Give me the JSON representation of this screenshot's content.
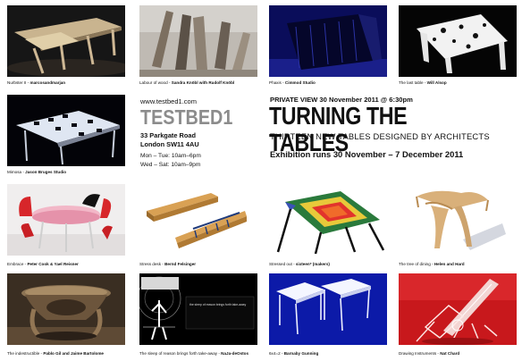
{
  "website": "www.testbed1.com",
  "gallery": "TESTBED1",
  "address": [
    "33 Parkgate Road",
    "London SW11 4AU"
  ],
  "hours": [
    "Mon – Tue: 10am–6pm",
    "Wed – Sat: 10am–9pm"
  ],
  "private_view": "PRIVATE VIEW  30 November 2011 @ 6:30pm",
  "title": "TURNING THE TABLES",
  "subtitle": "THIRTEEN NEW TABLES DESIGNED BY ARCHITECTS",
  "exhibition_runs": "Exhibition runs 30 November – 7 December 2011",
  "tables": [
    {
      "name": "Nurbster II - ",
      "designer": "marcosandmarjan"
    },
    {
      "name": "Labour of wood - ",
      "designer": "Sandra Knöbl with Rudolf Knöbl"
    },
    {
      "name": "Phaxis - ",
      "designer": "Cimmod Studio"
    },
    {
      "name": "The last table - ",
      "designer": "Will Alsop"
    },
    {
      "name": "Mimosa - ",
      "designer": "Jason Bruges Studio"
    },
    {
      "name": "Embrace - ",
      "designer": "Peter Cook & Yael Reisner"
    },
    {
      "name": "Stress desk - ",
      "designer": "Bernd Felsinger"
    },
    {
      "name": "Stressed out - ",
      "designer": "sixteen* (makers)"
    },
    {
      "name": "The tree of dining - ",
      "designer": "Helen and Hard"
    },
    {
      "name": "The indestructible - ",
      "designer": "Pablo Gil and Jaime Bartolome"
    },
    {
      "name": "The sleep of reason brings forth take-away - ",
      "designer": "NaJa-deOstos"
    },
    {
      "name": "6x4=2 - ",
      "designer": "Barnaby Gunning"
    },
    {
      "name": "Drawing Instruments - ",
      "designer": "Nat Chard"
    }
  ],
  "tile_inset_text": "the sleep of reason brings forth take-away",
  "colors": {
    "logo_grey": "#8c8c8c",
    "text": "#111111",
    "background": "#ffffff"
  }
}
